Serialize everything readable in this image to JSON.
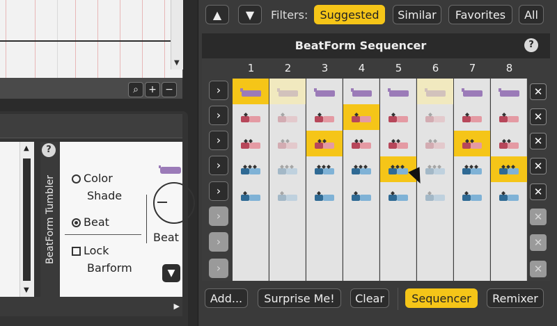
{
  "toolbar": {
    "up_icon": "chevron-up-icon",
    "down_icon": "chevron-down-icon",
    "filters_label": "Filters:",
    "filters": [
      {
        "label": "Suggested",
        "active": true
      },
      {
        "label": "Similar",
        "active": false
      },
      {
        "label": "Favorites",
        "active": false
      },
      {
        "label": "All",
        "active": false
      }
    ]
  },
  "sequencer": {
    "title": "BeatForm Sequencer",
    "help": "?",
    "columns": [
      "1",
      "2",
      "3",
      "4",
      "5",
      "6",
      "7",
      "8"
    ],
    "row_arrow": "›",
    "row_remove": "✕",
    "rows": [
      {
        "style": "purple",
        "enabled": true,
        "selected_col": 1,
        "faded_cols": [
          2,
          6
        ]
      },
      {
        "style": "red-1",
        "enabled": true,
        "selected_col": 4,
        "faded_cols": [
          2,
          6
        ]
      },
      {
        "style": "red-2",
        "enabled": true,
        "selected_cols": [
          3,
          7
        ],
        "faded_cols": [
          2,
          6
        ]
      },
      {
        "style": "blue-3",
        "enabled": true,
        "selected_cols": [
          5,
          8
        ],
        "faded_cols": [
          2,
          6
        ]
      },
      {
        "style": "blue-1",
        "enabled": true,
        "selected_cols": [],
        "faded_cols": [
          2,
          6
        ]
      },
      {
        "style": "empty",
        "enabled": false
      },
      {
        "style": "empty",
        "enabled": false
      },
      {
        "style": "empty",
        "enabled": false
      }
    ],
    "colors": {
      "purple": "#9b7bb8",
      "red": "#b7475a",
      "red_light": "#e49aa3",
      "blue": "#2f6a94",
      "blue_light": "#7fb2d6",
      "highlight": "#f5c518"
    }
  },
  "bottom_bar": {
    "add": "Add...",
    "surprise": "Surprise Me!",
    "clear": "Clear",
    "sequencer": "Sequencer",
    "remixer": "Remixer"
  },
  "tumbler": {
    "title": "BeatForm Tumbler",
    "help": "?",
    "options": {
      "color_shade_line1": "Color",
      "color_shade_line2": "Shade",
      "beat": "Beat",
      "lock_line1": "Lock",
      "lock_line2": "Barform"
    },
    "selected": "Beat",
    "dial_label": "Beat"
  },
  "zoom": {
    "search_icon": "magnifier-icon",
    "plus": "+",
    "minus": "−"
  }
}
